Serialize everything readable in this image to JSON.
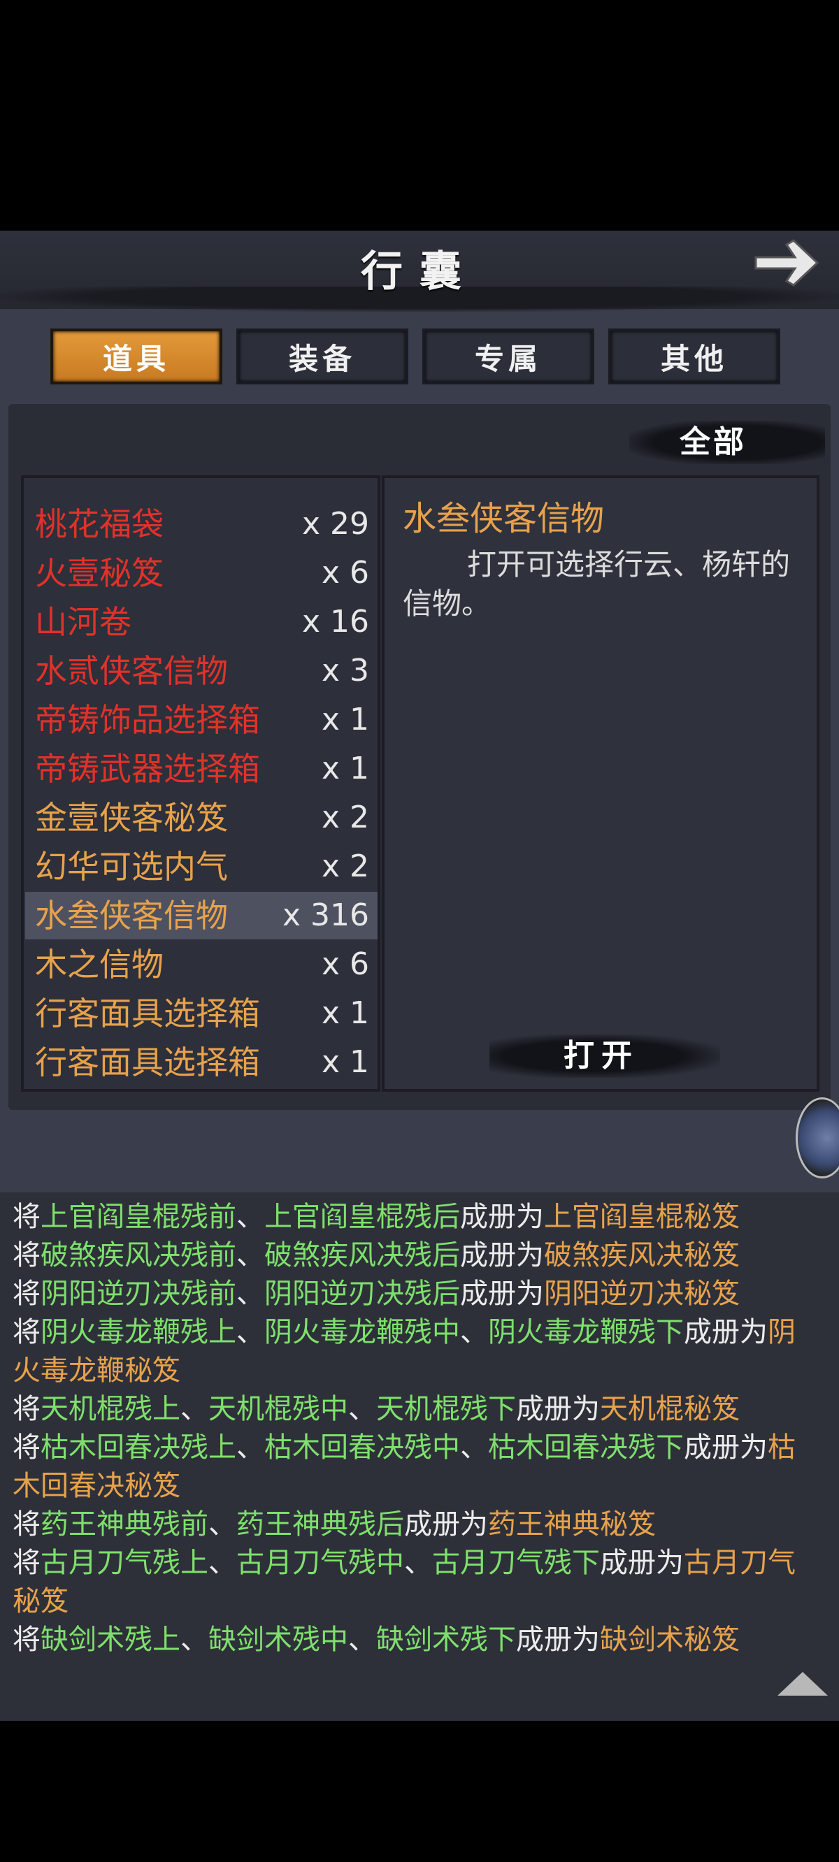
{
  "header": {
    "title": "行囊"
  },
  "tabs": [
    {
      "label": "道具",
      "active": true
    },
    {
      "label": "装备",
      "active": false
    },
    {
      "label": "专属",
      "active": false
    },
    {
      "label": "其他",
      "active": false
    }
  ],
  "filter": {
    "label": "全部"
  },
  "items": [
    {
      "name": "桃花福袋",
      "qty": "x 29",
      "color": "red"
    },
    {
      "name": "火壹秘笈",
      "qty": "x 6",
      "color": "red"
    },
    {
      "name": "山河卷",
      "qty": "x 16",
      "color": "red"
    },
    {
      "name": "水贰侠客信物",
      "qty": "x 3",
      "color": "red"
    },
    {
      "name": "帝铸饰品选择箱",
      "qty": "x 1",
      "color": "red"
    },
    {
      "name": "帝铸武器选择箱",
      "qty": "x 1",
      "color": "red"
    },
    {
      "name": "金壹侠客秘笈",
      "qty": "x 2",
      "color": "gold"
    },
    {
      "name": "幻华可选内气",
      "qty": "x 2",
      "color": "gold"
    },
    {
      "name": "水叁侠客信物",
      "qty": "x 316",
      "color": "gold",
      "selected": true
    },
    {
      "name": "木之信物",
      "qty": "x 6",
      "color": "gold"
    },
    {
      "name": "行客面具选择箱",
      "qty": "x 1",
      "color": "gold"
    },
    {
      "name": "行客面具选择箱",
      "qty": "x 1",
      "color": "gold"
    }
  ],
  "detail": {
    "title": "水叁侠客信物",
    "description": "打开可选择行云、杨轩的信物。",
    "open_label": "打开"
  },
  "log": [
    [
      [
        "将",
        "w"
      ],
      [
        "上官阎皇棍残前",
        "g"
      ],
      [
        "、",
        "w"
      ],
      [
        "上官阎皇棍残后",
        "g"
      ],
      [
        "成册为",
        "w"
      ],
      [
        "上官阎皇棍秘笈",
        "o"
      ]
    ],
    [
      [
        "将",
        "w"
      ],
      [
        "破煞疾风决残前",
        "g"
      ],
      [
        "、",
        "w"
      ],
      [
        "破煞疾风决残后",
        "g"
      ],
      [
        "成册为",
        "w"
      ],
      [
        "破煞疾风决秘笈",
        "o"
      ]
    ],
    [
      [
        "将",
        "w"
      ],
      [
        "阴阳逆刃决残前",
        "g"
      ],
      [
        "、",
        "w"
      ],
      [
        "阴阳逆刃决残后",
        "g"
      ],
      [
        "成册为",
        "w"
      ],
      [
        "阴阳逆刃决秘笈",
        "o"
      ]
    ],
    [
      [
        "将",
        "w"
      ],
      [
        "阴火毒龙鞭残上",
        "g"
      ],
      [
        "、",
        "w"
      ],
      [
        "阴火毒龙鞭残中",
        "g"
      ],
      [
        "、",
        "w"
      ],
      [
        "阴火毒龙鞭残下",
        "g"
      ],
      [
        "成册为",
        "w"
      ],
      [
        "阴",
        "o"
      ]
    ],
    [
      [
        "火毒龙鞭秘笈",
        "o"
      ]
    ],
    [
      [
        "将",
        "w"
      ],
      [
        "天机棍残上",
        "g"
      ],
      [
        "、",
        "w"
      ],
      [
        "天机棍残中",
        "g"
      ],
      [
        "、",
        "w"
      ],
      [
        "天机棍残下",
        "g"
      ],
      [
        "成册为",
        "w"
      ],
      [
        "天机棍秘笈",
        "o"
      ]
    ],
    [
      [
        "将",
        "w"
      ],
      [
        "枯木回春决残上",
        "g"
      ],
      [
        "、",
        "w"
      ],
      [
        "枯木回春决残中",
        "g"
      ],
      [
        "、",
        "w"
      ],
      [
        "枯木回春决残下",
        "g"
      ],
      [
        "成册为",
        "w"
      ],
      [
        "枯",
        "o"
      ]
    ],
    [
      [
        "木回春决秘笈",
        "o"
      ]
    ],
    [
      [
        "将",
        "w"
      ],
      [
        "药王神典残前",
        "g"
      ],
      [
        "、",
        "w"
      ],
      [
        "药王神典残后",
        "g"
      ],
      [
        "成册为",
        "w"
      ],
      [
        "药王神典秘笈",
        "o"
      ]
    ],
    [
      [
        "将",
        "w"
      ],
      [
        "古月刀气残上",
        "g"
      ],
      [
        "、",
        "w"
      ],
      [
        "古月刀气残中",
        "g"
      ],
      [
        "、",
        "w"
      ],
      [
        "古月刀气残下",
        "g"
      ],
      [
        "成册为",
        "w"
      ],
      [
        "古月刀气",
        "o"
      ]
    ],
    [
      [
        "秘笈",
        "o"
      ]
    ],
    [
      [
        "将",
        "w"
      ],
      [
        "缺剑术残上",
        "g"
      ],
      [
        "、",
        "w"
      ],
      [
        "缺剑术残中",
        "g"
      ],
      [
        "、",
        "w"
      ],
      [
        "缺剑术残下",
        "g"
      ],
      [
        "成册为",
        "w"
      ],
      [
        "缺剑术秘笈",
        "o"
      ]
    ]
  ]
}
